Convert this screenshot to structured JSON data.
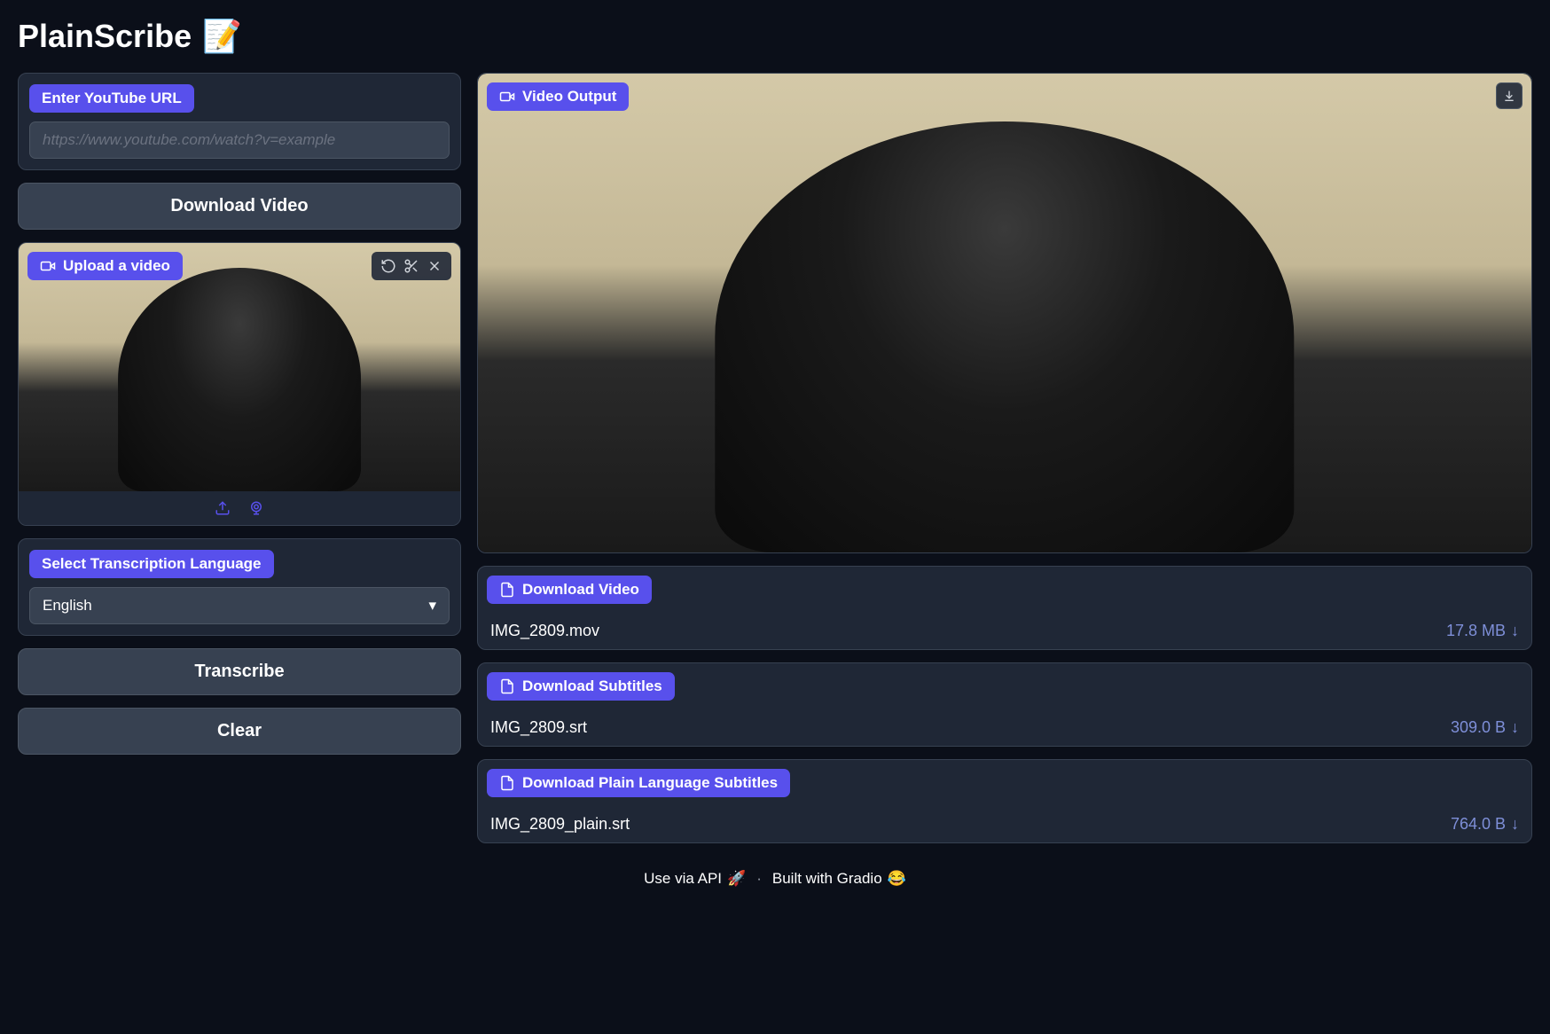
{
  "app": {
    "title": "PlainScribe",
    "title_emoji": "📝"
  },
  "input": {
    "url_label": "Enter YouTube URL",
    "url_placeholder": "https://www.youtube.com/watch?v=example",
    "url_value": "",
    "download_button": "Download Video",
    "upload_label": "Upload a video",
    "language_label": "Select Transcription Language",
    "language_value": "English",
    "transcribe_button": "Transcribe",
    "clear_button": "Clear"
  },
  "output": {
    "video_label": "Video Output",
    "downloads": [
      {
        "label": "Download Video",
        "filename": "IMG_2809.mov",
        "size": "17.8 MB"
      },
      {
        "label": "Download Subtitles",
        "filename": "IMG_2809.srt",
        "size": "309.0 B"
      },
      {
        "label": "Download Plain Language Subtitles",
        "filename": "IMG_2809_plain.srt",
        "size": "764.0 B"
      }
    ]
  },
  "footer": {
    "api_text": "Use via API",
    "api_emoji": "🚀",
    "separator": "·",
    "built_text": "Built with Gradio",
    "built_emoji": "😂"
  }
}
